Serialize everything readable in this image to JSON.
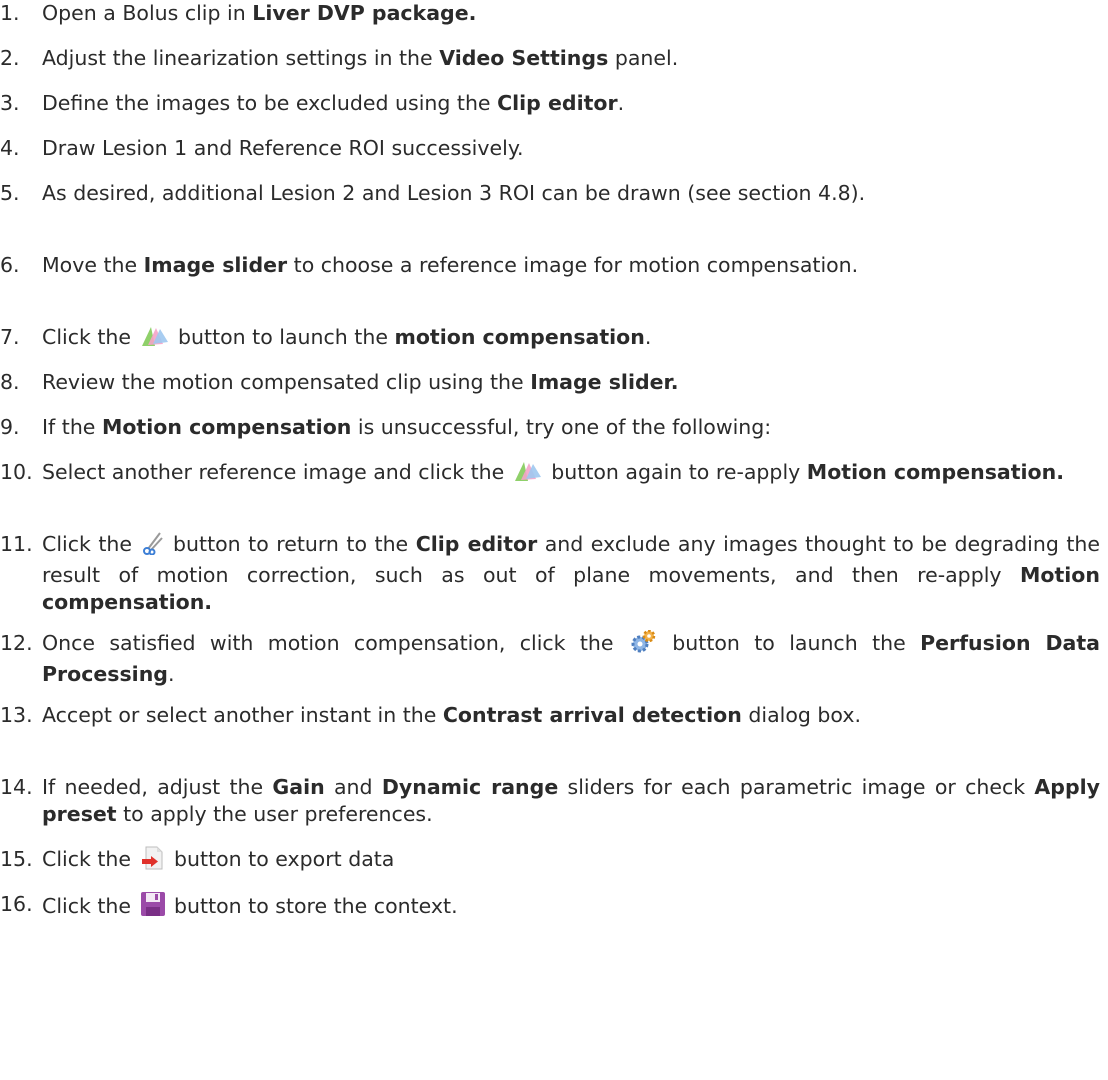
{
  "steps": [
    {
      "num": "1.",
      "segments": [
        {
          "t": "Open a Bolus clip in "
        },
        {
          "t": "Liver DVP package.",
          "b": true
        }
      ]
    },
    {
      "num": "2.",
      "segments": [
        {
          "t": "Adjust the linearization settings in the "
        },
        {
          "t": "Video Settings",
          "b": true
        },
        {
          "t": " panel."
        }
      ]
    },
    {
      "num": "3.",
      "segments": [
        {
          "t": "Define the images to be excluded using the "
        },
        {
          "t": "Clip editor",
          "b": true
        },
        {
          "t": "."
        }
      ]
    },
    {
      "num": "4.",
      "segments": [
        {
          "t": "Draw Lesion 1 and Reference ROI successively."
        }
      ]
    },
    {
      "num": "5.",
      "segments": [
        {
          "t": "As desired, additional Lesion 2 and Lesion 3 ROI can be drawn (see section 4.8)."
        }
      ]
    },
    {
      "num": "6.",
      "segments": [
        {
          "t": "Move the "
        },
        {
          "t": "Image slider",
          "b": true
        },
        {
          "t": " to choose a reference image for motion compensation."
        }
      ]
    },
    {
      "num": "7.",
      "segments": [
        {
          "t": "Click the "
        },
        {
          "icon": "motion-compensation-icon"
        },
        {
          "t": " button to launch the "
        },
        {
          "t": "motion compensation",
          "b": true
        },
        {
          "t": "."
        }
      ]
    },
    {
      "num": "8.",
      "segments": [
        {
          "t": "Review the motion compensated clip using the "
        },
        {
          "t": "Image slider.",
          "b": true
        }
      ]
    },
    {
      "num": "9.",
      "segments": [
        {
          "t": "If the "
        },
        {
          "t": "Motion compensation",
          "b": true
        },
        {
          "t": " is unsuccessful, try one of the following:"
        }
      ]
    },
    {
      "num": "10.",
      "segments": [
        {
          "t": "Select another reference image and click the "
        },
        {
          "icon": "motion-compensation-icon"
        },
        {
          "t": " button again to re-apply "
        },
        {
          "t": "Motion compensation.",
          "b": true
        }
      ]
    },
    {
      "num": "11.",
      "segments": [
        {
          "t": "Click the "
        },
        {
          "icon": "scissors-icon"
        },
        {
          "t": " button to return to the "
        },
        {
          "t": "Clip editor",
          "b": true
        },
        {
          "t": " and exclude any images thought to be degrading the result of motion correction, such as out of plane movements, and then re-apply "
        },
        {
          "t": "Motion compensation.",
          "b": true
        }
      ]
    },
    {
      "num": "12.",
      "segments": [
        {
          "t": "Once satisfied with motion compensation, click the "
        },
        {
          "icon": "gears-icon"
        },
        {
          "t": " button to launch the "
        },
        {
          "t": "Perfusion Data Processing",
          "b": true
        },
        {
          "t": "."
        }
      ]
    },
    {
      "num": "13.",
      "segments": [
        {
          "t": "Accept or select another instant in the "
        },
        {
          "t": "Contrast arrival detection",
          "b": true
        },
        {
          "t": " dialog box."
        }
      ]
    },
    {
      "num": "14.",
      "segments": [
        {
          "t": "If needed, adjust the "
        },
        {
          "t": "Gain",
          "b": true
        },
        {
          "t": " and "
        },
        {
          "t": "Dynamic range",
          "b": true
        },
        {
          "t": " sliders for each parametric image or check "
        },
        {
          "t": "Apply preset",
          "b": true
        },
        {
          "t": " to apply the user preferences."
        }
      ]
    },
    {
      "num": "15.",
      "segments": [
        {
          "t": "Click the "
        },
        {
          "icon": "export-icon"
        },
        {
          "t": " button to export data"
        }
      ]
    },
    {
      "num": "16.",
      "segments": [
        {
          "t": "Click the "
        },
        {
          "icon": "save-icon"
        },
        {
          "t": " button to store the context."
        }
      ]
    }
  ]
}
